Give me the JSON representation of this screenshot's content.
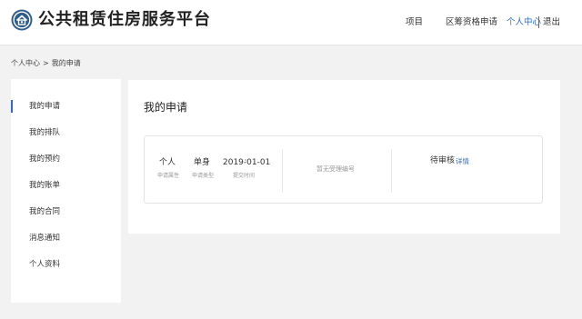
{
  "header": {
    "site_title": "公共租赁住房服务平台",
    "nav": {
      "projects": "项目",
      "qualification": "区筹资格申请",
      "user_center": "个人中心",
      "logout": "退出"
    }
  },
  "breadcrumb": {
    "parent": "个人中心",
    "separator": ">",
    "current": "我的申请"
  },
  "sidebar": {
    "items": [
      {
        "label": "我的申请"
      },
      {
        "label": "我的排队"
      },
      {
        "label": "我的预约"
      },
      {
        "label": "我的账单"
      },
      {
        "label": "我的合同"
      },
      {
        "label": "消息通知"
      },
      {
        "label": "个人资料"
      }
    ]
  },
  "main": {
    "title": "我的申请",
    "application": {
      "attribute": {
        "value": "个人",
        "label": "申请属性"
      },
      "type": {
        "value": "单身",
        "label": "申请类型"
      },
      "submit_time": {
        "value": "2019-01-01",
        "label": "提交时间"
      },
      "acceptance_number": "暂无受理编号",
      "status": "待审核",
      "detail_link": "详情"
    }
  },
  "colors": {
    "accent": "#2f6bc8",
    "page_background": "#f2f2f2",
    "card_background": "#ffffff"
  },
  "icons": {
    "logo": "house-emblem-icon"
  }
}
